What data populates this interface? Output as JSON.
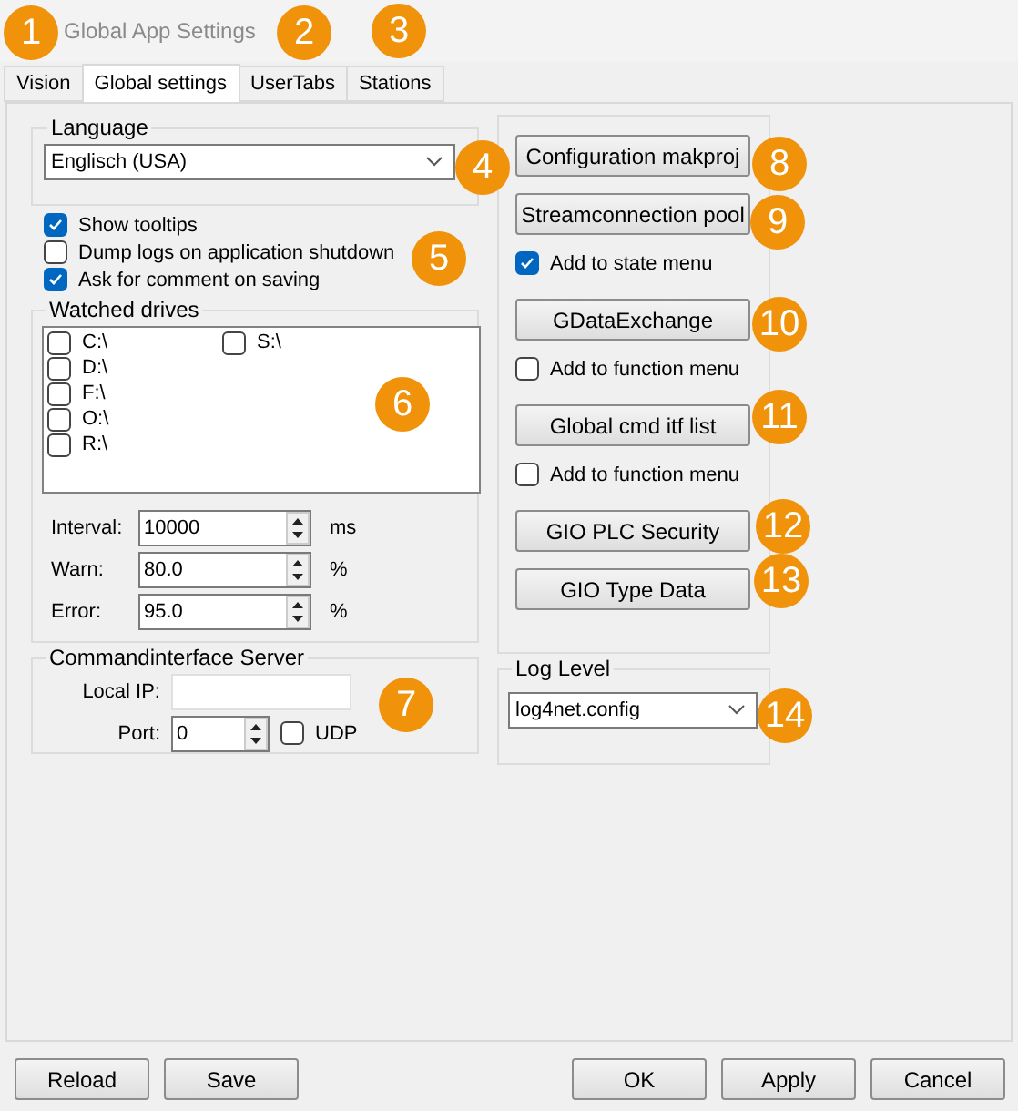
{
  "window": {
    "title": "Global App Settings"
  },
  "tabs": [
    {
      "label": "Vision",
      "selected": false
    },
    {
      "label": "Global settings",
      "selected": true
    },
    {
      "label": "UserTabs",
      "selected": false
    },
    {
      "label": "Stations",
      "selected": false
    }
  ],
  "language": {
    "label": "Language",
    "value": "Englisch (USA)"
  },
  "options": [
    {
      "label": "Show tooltips",
      "checked": true
    },
    {
      "label": "Dump logs on application shutdown",
      "checked": false
    },
    {
      "label": "Ask for comment on saving",
      "checked": true
    }
  ],
  "watched_drives": {
    "label": "Watched drives",
    "drives": [
      {
        "label": "C:\\",
        "checked": false
      },
      {
        "label": "D:\\",
        "checked": false
      },
      {
        "label": "F:\\",
        "checked": false
      },
      {
        "label": "O:\\",
        "checked": false
      },
      {
        "label": "R:\\",
        "checked": false
      },
      {
        "label": "S:\\",
        "checked": false
      }
    ],
    "fields": [
      {
        "label": "Interval:",
        "value": "10000",
        "unit": "ms"
      },
      {
        "label": "Warn:",
        "value": "80.0",
        "unit": "%"
      },
      {
        "label": "Error:",
        "value": "95.0",
        "unit": "%"
      }
    ]
  },
  "command_interface": {
    "label": "Commandinterface Server",
    "local_ip_label": "Local IP:",
    "port_label": "Port:",
    "port": "0",
    "udp": {
      "label": "UDP",
      "checked": false
    }
  },
  "actions": [
    {
      "kind": "button",
      "label": "Configuration makproj"
    },
    {
      "kind": "button",
      "label": "Streamconnection pool"
    },
    {
      "kind": "checkbox",
      "label": "Add to state menu",
      "checked": true
    },
    {
      "kind": "button",
      "label": "GDataExchange"
    },
    {
      "kind": "checkbox",
      "label": "Add to function menu",
      "checked": false
    },
    {
      "kind": "button",
      "label": "Global cmd itf list"
    },
    {
      "kind": "checkbox",
      "label": "Add to function menu",
      "checked": false
    },
    {
      "kind": "button",
      "label": "GIO PLC Security"
    },
    {
      "kind": "button",
      "label": "GIO Type Data"
    }
  ],
  "log_level": {
    "label": "Log Level",
    "value": "log4net.config"
  },
  "footer_left": [
    "Reload",
    "Save"
  ],
  "footer_right": [
    "OK",
    "Apply",
    "Cancel"
  ],
  "callouts": [
    "1",
    "2",
    "3",
    "4",
    "5",
    "6",
    "7",
    "8",
    "9",
    "10",
    "11",
    "12",
    "13",
    "14"
  ]
}
